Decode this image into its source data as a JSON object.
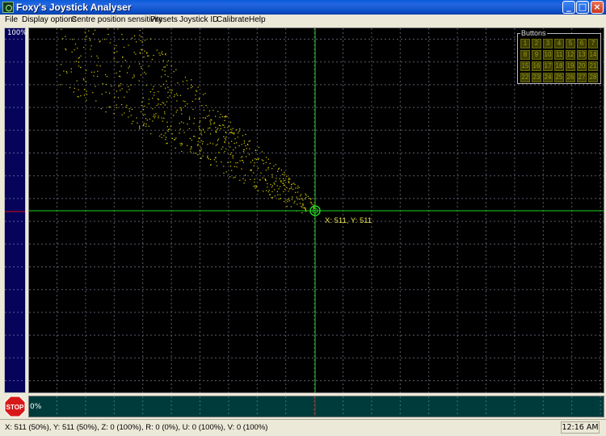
{
  "window": {
    "title": "Foxy's Joystick Analyser"
  },
  "menu": [
    "File",
    "Display options",
    "Centre position sensitivity",
    "Presets",
    "Joystick ID",
    "Calibrate",
    "Help"
  ],
  "left_bar": {
    "top_label": "100%"
  },
  "bottom_bar": {
    "left_label": "0%"
  },
  "stop_button": {
    "label": "STOP"
  },
  "buttons_panel": {
    "title": "Buttons",
    "buttons": [
      "1",
      "2",
      "3",
      "4",
      "5",
      "6",
      "7",
      "8",
      "9",
      "10",
      "11",
      "12",
      "13",
      "14",
      "15",
      "16",
      "17",
      "18",
      "19",
      "20",
      "21",
      "22",
      "23",
      "24",
      "25",
      "26",
      "27",
      "28"
    ]
  },
  "crosshair_label": "X: 511, Y: 511",
  "status": {
    "readout": "X: 511 (50%), Y: 511 (50%), Z: 0 (100%), R: 0 (0%), U: 0 (100%), V: 0 (100%)",
    "clock": "12:16 AM"
  },
  "colors": {
    "grid": "#5a5a6a",
    "trace": "#d8d000",
    "crosshair": "#1fd01f",
    "plot_bg": "#000000",
    "left_bar_bg": "#06045a",
    "bottom_bar_bg": "#003b3b"
  }
}
